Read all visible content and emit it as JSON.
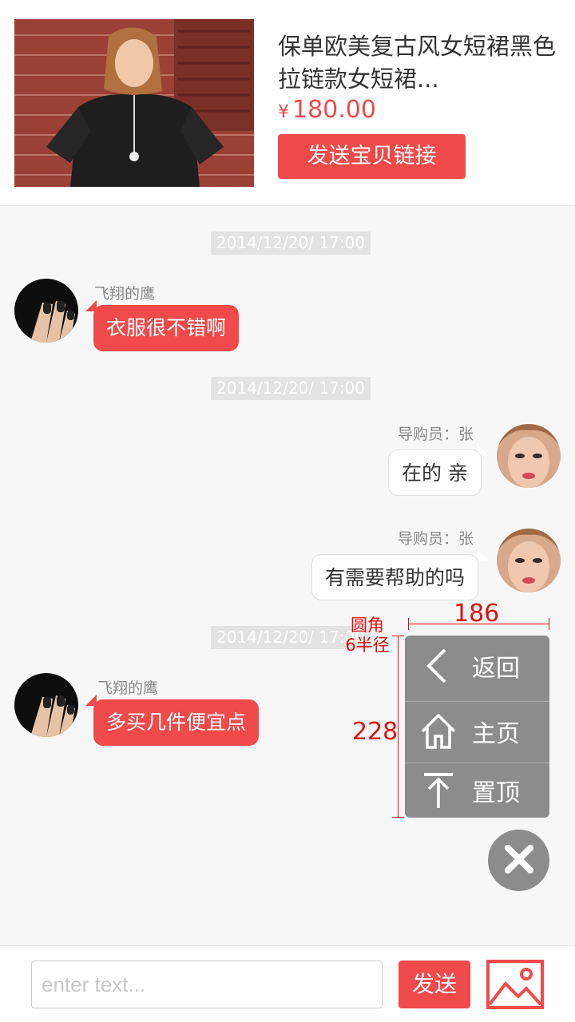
{
  "product": {
    "title": "保单欧美复古风女短裙黑色拉链款女短裙...",
    "currency": "¥",
    "price": "180.00",
    "send_link_label": "发送宝贝链接"
  },
  "messages": [
    {
      "type": "timestamp",
      "text": "2014/12/20/  17:00"
    },
    {
      "type": "customer",
      "name": "飞翔的鹰",
      "text": "衣服很不错啊"
    },
    {
      "type": "timestamp",
      "text": "2014/12/20/  17:00"
    },
    {
      "type": "agent",
      "name": "导购员：张",
      "text": "在的 亲"
    },
    {
      "type": "agent",
      "name": "导购员：张",
      "text": "有需要帮助的吗"
    },
    {
      "type": "timestamp",
      "text": "2014/12/20/  17:00"
    },
    {
      "type": "customer",
      "name": "飞翔的鹰",
      "text": "多买几件便宜点"
    }
  ],
  "float_menu": {
    "items": [
      {
        "label": "返回",
        "icon": "chevron-left-icon"
      },
      {
        "label": "主页",
        "icon": "home-icon"
      },
      {
        "label": "置顶",
        "icon": "arrow-to-top-icon"
      }
    ]
  },
  "annotations": {
    "radius_line1": "圆角",
    "radius_line2": "6半径",
    "width": "186",
    "height": "228"
  },
  "input": {
    "placeholder": "enter text..."
  },
  "send_label": "发送",
  "colors": {
    "accent": "#f04a4a",
    "menu_bg": "#8c8c8c",
    "annotation": "#e01010"
  }
}
